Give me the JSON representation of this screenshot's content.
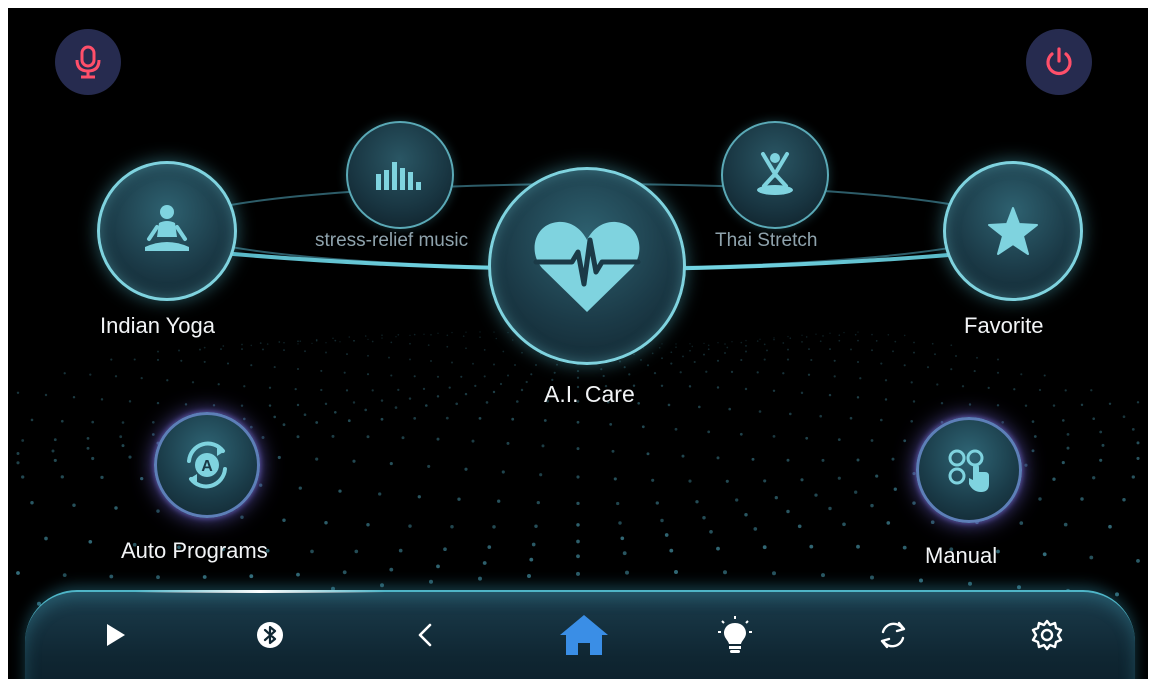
{
  "colors": {
    "accent_cyan": "#7fd3df",
    "home_blue": "#3a8ee6",
    "power_red": "#ff4f6a",
    "mic_red": "#ff4f6a",
    "corner_button_bg": "#262b4f",
    "background": "#000000"
  },
  "top": {
    "mic_icon": "microphone-icon",
    "power_icon": "power-icon"
  },
  "carousel": {
    "indian_yoga": {
      "label": "Indian Yoga",
      "icon": "yoga-meditation-icon"
    },
    "stress_relief": {
      "label": "stress-relief music",
      "icon": "equalizer-bars-icon"
    },
    "ai_care": {
      "label": "A.I. Care",
      "icon": "heart-pulse-icon"
    },
    "thai_stretch": {
      "label": "Thai Stretch",
      "icon": "stretch-massage-icon"
    },
    "favorite": {
      "label": "Favorite",
      "icon": "star-icon"
    }
  },
  "secondary": {
    "auto_programs": {
      "label": "Auto Programs",
      "icon": "auto-cycle-icon"
    },
    "manual": {
      "label": "Manual",
      "icon": "manual-touch-icon"
    }
  },
  "bottom_nav": [
    {
      "name": "play",
      "icon": "play-icon"
    },
    {
      "name": "bluetooth",
      "icon": "bluetooth-icon"
    },
    {
      "name": "back",
      "icon": "chevron-left-icon"
    },
    {
      "name": "home",
      "icon": "home-icon",
      "active": true
    },
    {
      "name": "light",
      "icon": "lightbulb-icon"
    },
    {
      "name": "sync",
      "icon": "sync-icon"
    },
    {
      "name": "settings",
      "icon": "gear-icon"
    }
  ]
}
